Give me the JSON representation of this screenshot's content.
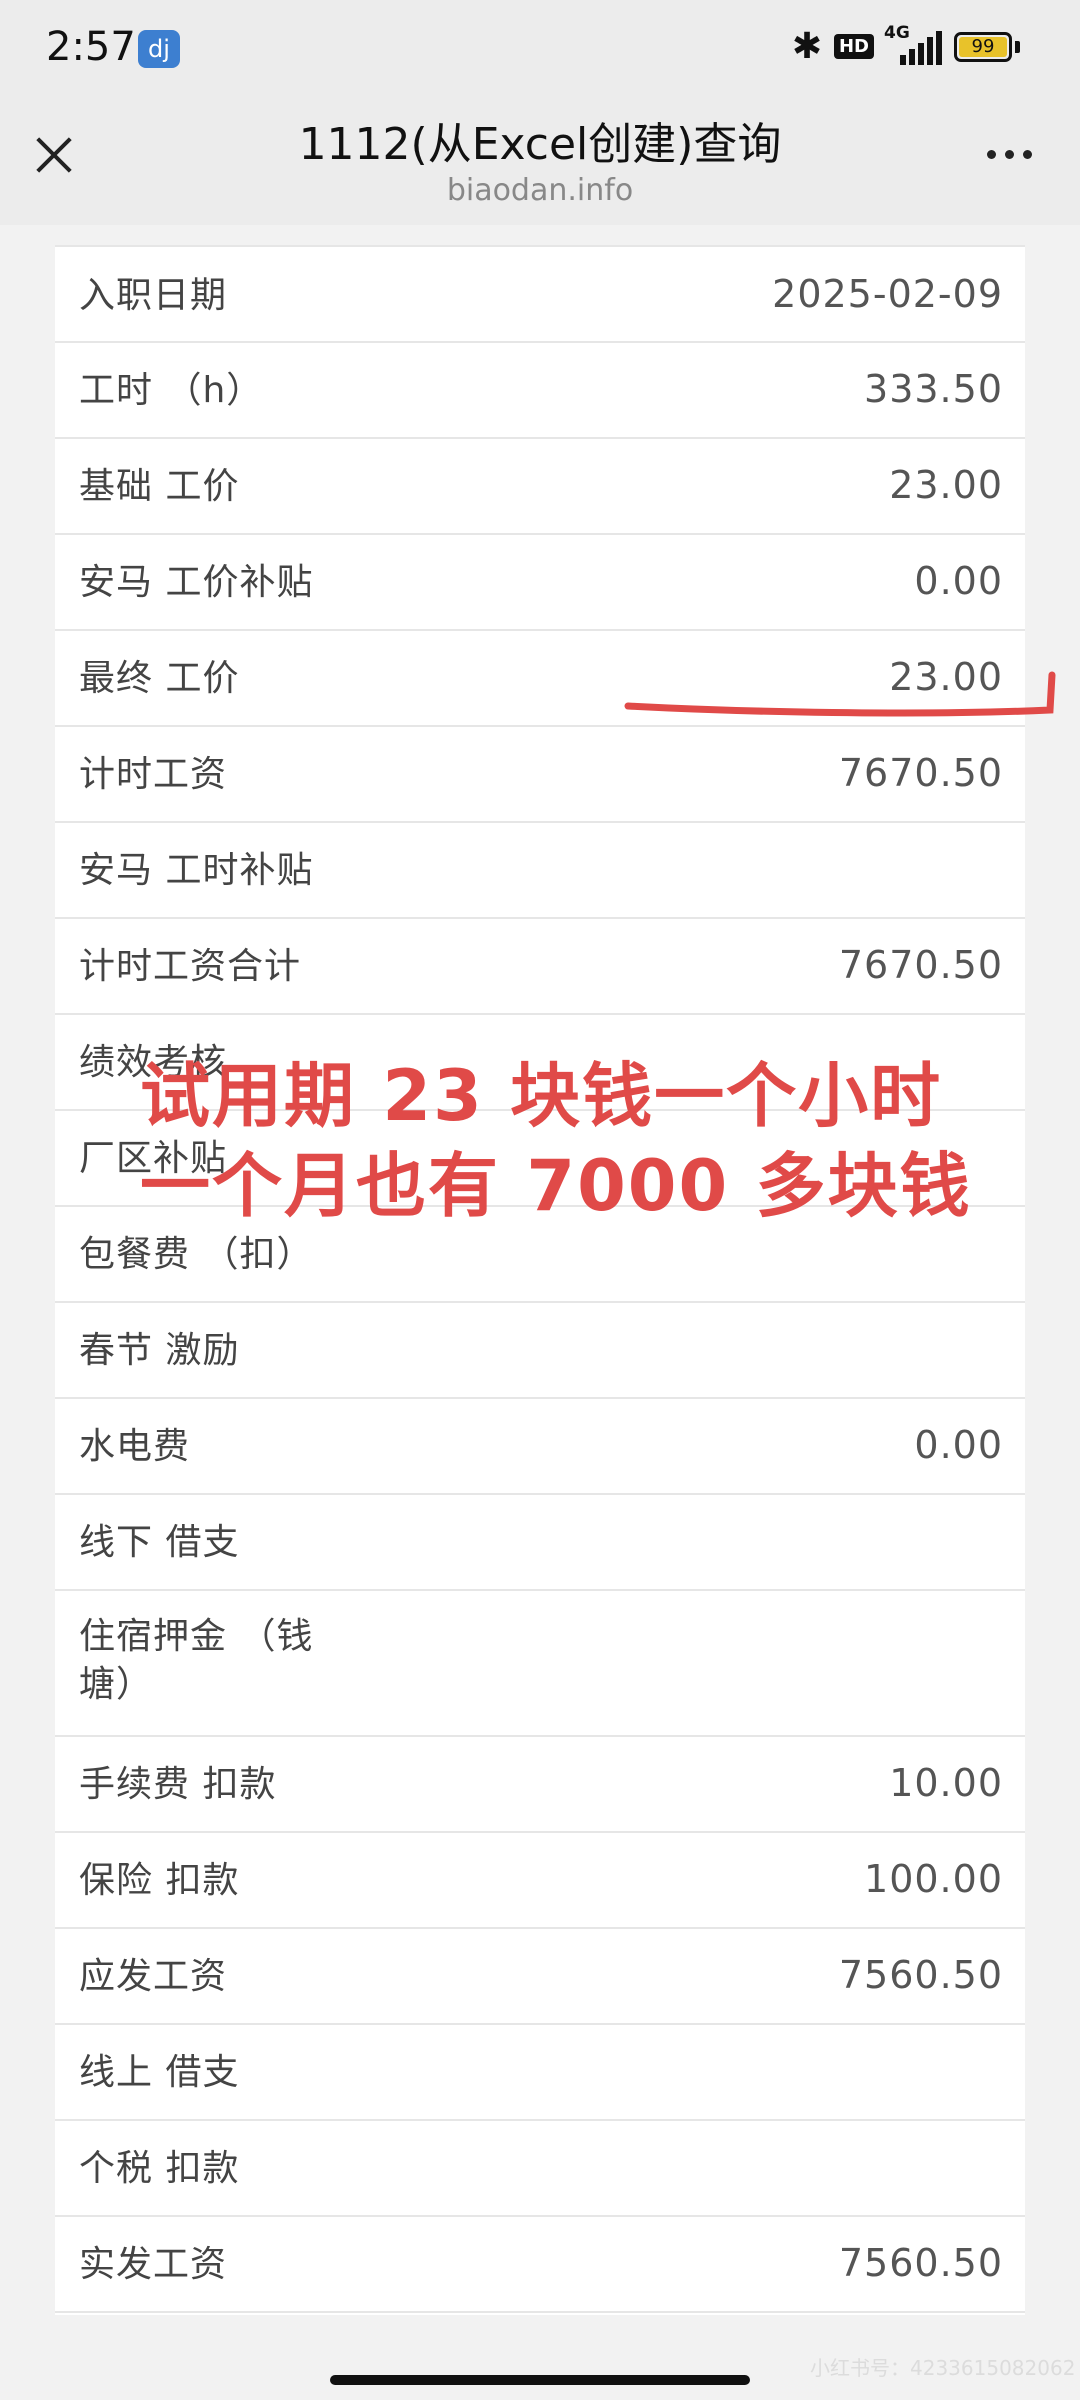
{
  "status_bar": {
    "time": "2:57",
    "app_icon_text": "dj",
    "icons": [
      "bluetooth-icon",
      "hd-icon",
      "signal-4g-icon",
      "battery-icon"
    ],
    "hd": "HD",
    "network": "4G",
    "battery": "99"
  },
  "nav": {
    "title": "1112(从Excel创建)查询",
    "subtitle": "biaodan.info"
  },
  "rows": [
    {
      "label": "入职日期",
      "value": "2025-02-09"
    },
    {
      "label": "工时 （h）",
      "value": "333.50"
    },
    {
      "label": "基础 工价",
      "value": "23.00"
    },
    {
      "label": "安马 工价补贴",
      "value": "0.00"
    },
    {
      "label": "最终 工价",
      "value": "23.00"
    },
    {
      "label": "计时工资",
      "value": "7670.50"
    },
    {
      "label": "安马 工时补贴",
      "value": ""
    },
    {
      "label": "计时工资合计",
      "value": "7670.50"
    },
    {
      "label": "绩效考核",
      "value": ""
    },
    {
      "label": "厂区补贴",
      "value": ""
    },
    {
      "label": "包餐费 （扣）",
      "value": ""
    },
    {
      "label": "春节 激励",
      "value": ""
    },
    {
      "label": "水电费",
      "value": "0.00"
    },
    {
      "label": "线下 借支",
      "value": ""
    },
    {
      "label": "住宿押金 （钱\n塘）",
      "value": ""
    },
    {
      "label": "手续费 扣款",
      "value": "10.00"
    },
    {
      "label": "保险 扣款",
      "value": "100.00"
    },
    {
      "label": "应发工资",
      "value": "7560.50"
    },
    {
      "label": "线上 借支",
      "value": ""
    },
    {
      "label": "个税 扣款",
      "value": ""
    },
    {
      "label": "实发工资",
      "value": "7560.50"
    }
  ],
  "annotation": {
    "line1": "试用期 23 块钱一个小时",
    "line2": "一个月也有 7000 多块钱",
    "color": "#e04a48"
  },
  "watermark": "小红书号：4233615082062"
}
